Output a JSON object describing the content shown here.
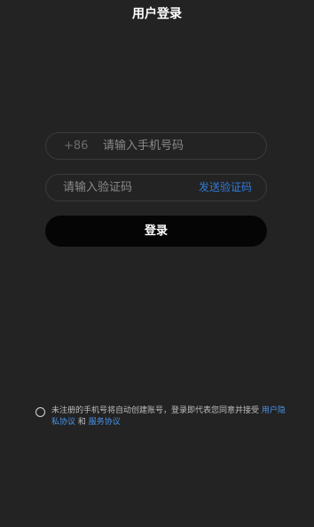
{
  "header": {
    "title": "用户登录"
  },
  "phone": {
    "country_code": "+86",
    "placeholder": "请输入手机号码"
  },
  "code": {
    "placeholder": "请输入验证码",
    "send_label": "发送验证码"
  },
  "login": {
    "label": "登录"
  },
  "agreement": {
    "text_before": "未注册的手机号将自动创建账号，登录即代表您同意并接受 ",
    "privacy_link": "用户隐私协议",
    "and": " 和 ",
    "service_link": "服务协议"
  },
  "colors": {
    "background": "#232323",
    "link": "#2f7bd9",
    "button": "#050505"
  }
}
